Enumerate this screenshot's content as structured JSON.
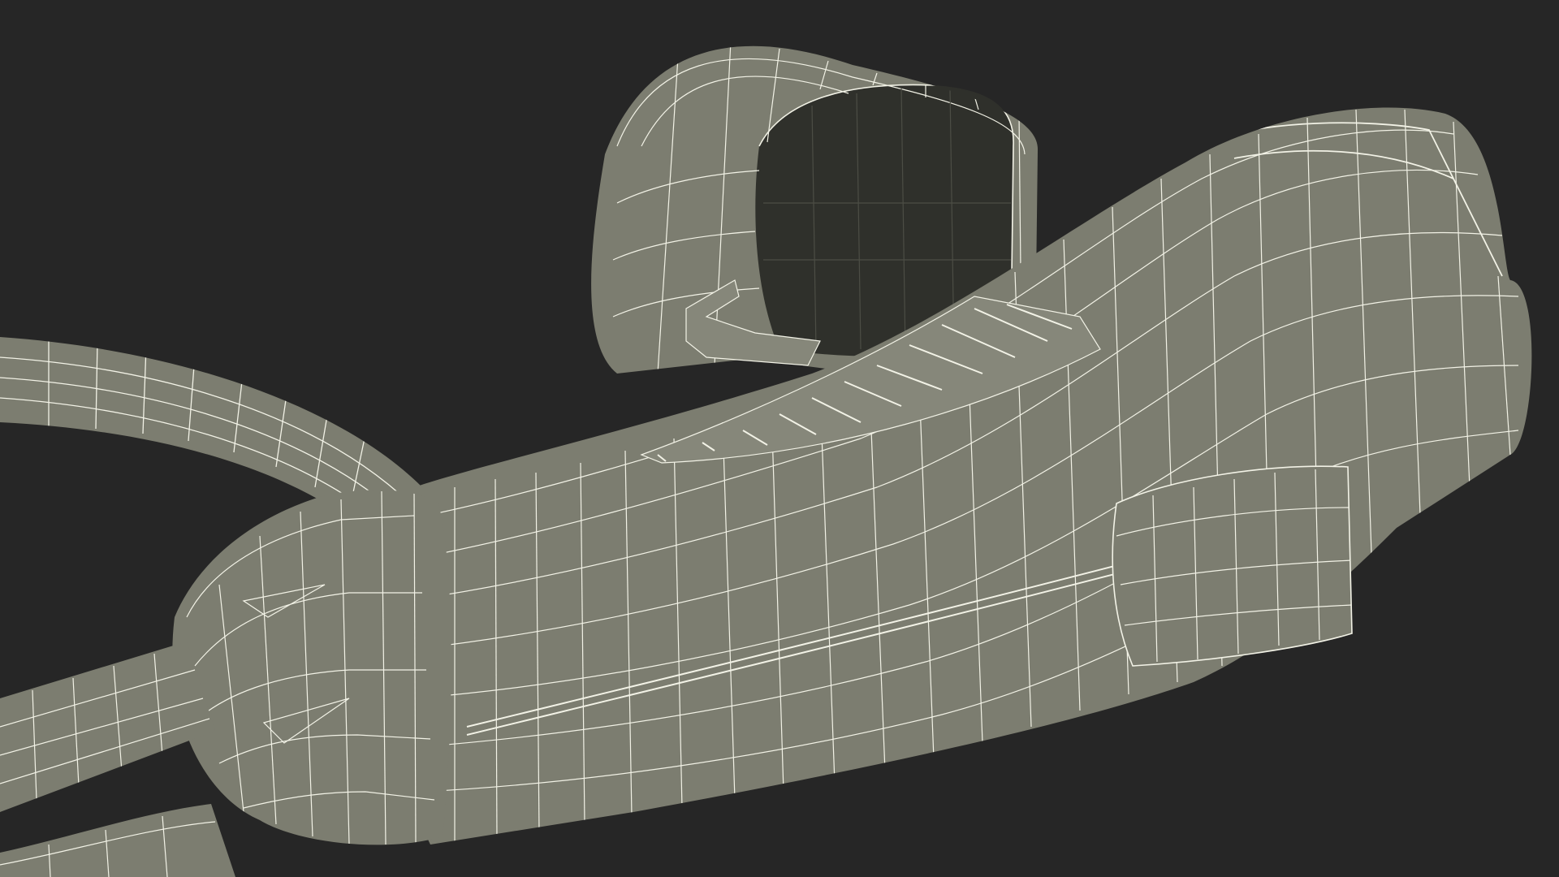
{
  "scene": {
    "background_color": "#262626",
    "surface_color": "#7c7d70",
    "surface_light_color": "#86877a",
    "surface_dark_color": "#5f6056",
    "cavity_color": "#2f302b",
    "wire_color": "#f2f2e6"
  }
}
